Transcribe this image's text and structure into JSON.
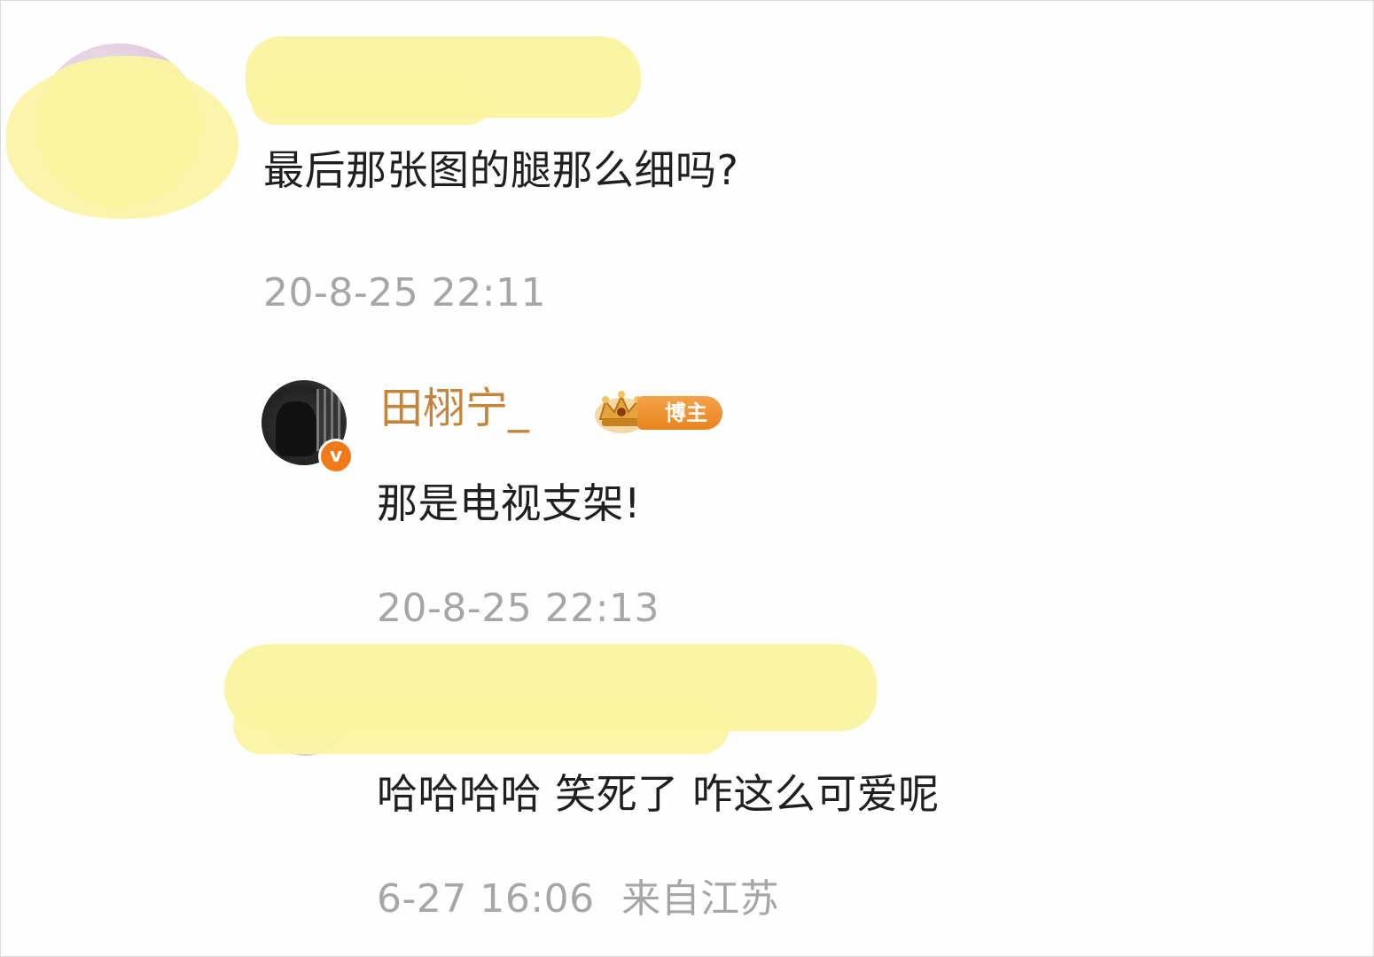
{
  "comments": [
    {
      "author": "",
      "text": "最后那张图的腿那么细吗?",
      "time": "20-8-25 22:11"
    },
    {
      "author": "田栩宁_",
      "badge": "博主",
      "verified_mark": "v",
      "text": "那是电视支架!",
      "time": "20-8-25 22:13"
    },
    {
      "author": "",
      "text": "哈哈哈哈 笑死了 咋这么可爱呢",
      "time": "6-27 16:06",
      "location": "来自江苏"
    }
  ],
  "colors": {
    "text": "#1f1f1f",
    "timestamp": "#a6a6a6",
    "blogger_name": "#c4853a",
    "badge_orange": "#e98420",
    "redaction_yellow": "#faf4a0"
  },
  "icons": [
    "crown-icon",
    "verified-icon"
  ]
}
